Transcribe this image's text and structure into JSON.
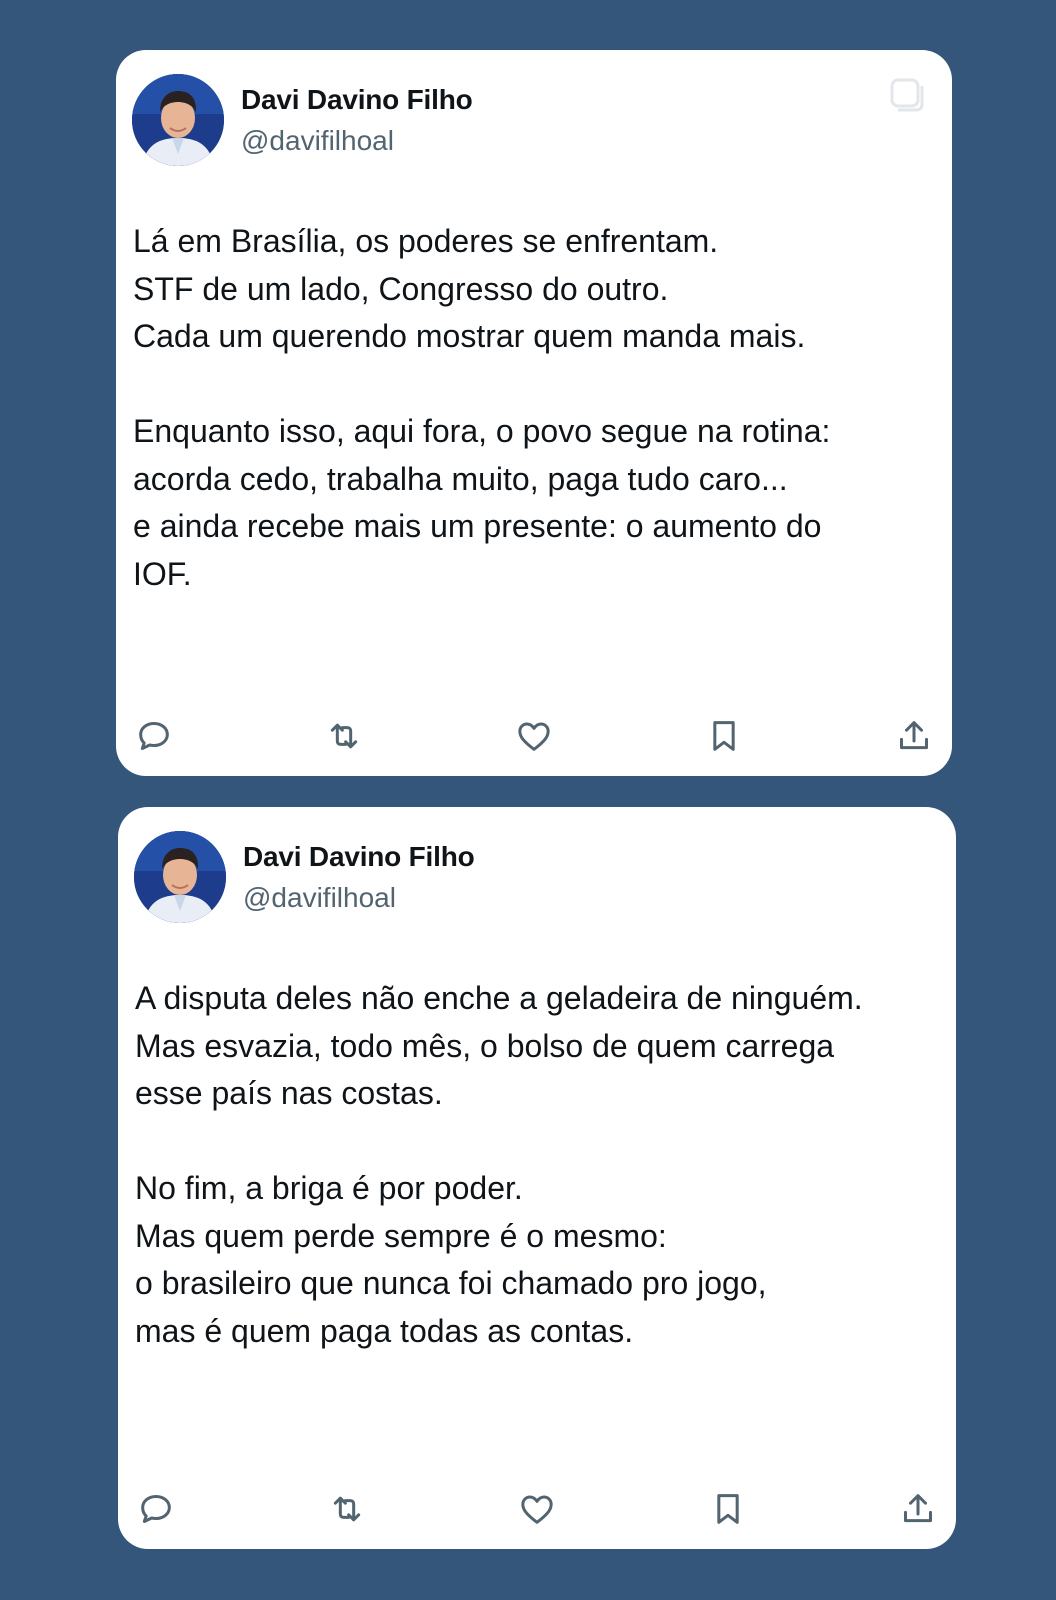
{
  "background_color": "#34567a",
  "text_color": "#0f1419",
  "secondary_text_color": "#536471",
  "icons": {
    "copy": "copy-icon",
    "reply": "reply-icon",
    "retweet": "retweet-icon",
    "like": "heart-icon",
    "bookmark": "bookmark-icon",
    "share": "share-icon"
  },
  "tweets": [
    {
      "author": {
        "name": "Davi Davino Filho",
        "handle": "@davifilhoal"
      },
      "paragraphs": [
        "Lá em Brasília, os poderes se enfrentam.\nSTF de um lado, Congresso do outro.\nCada um querendo mostrar quem manda mais.",
        "Enquanto isso, aqui fora, o povo segue na rotina:\nacorda cedo, trabalha muito, paga tudo caro...\ne ainda recebe mais um presente: o aumento do\nIOF."
      ]
    },
    {
      "author": {
        "name": "Davi Davino Filho",
        "handle": "@davifilhoal"
      },
      "paragraphs": [
        "A disputa deles não enche a geladeira de ninguém.\nMas esvazia, todo mês, o bolso de quem carrega\nesse país nas costas.",
        "No fim, a briga é por poder.\nMas quem perde sempre é o mesmo:\no brasileiro que nunca foi chamado pro jogo,\nmas é quem paga todas as contas."
      ]
    }
  ]
}
